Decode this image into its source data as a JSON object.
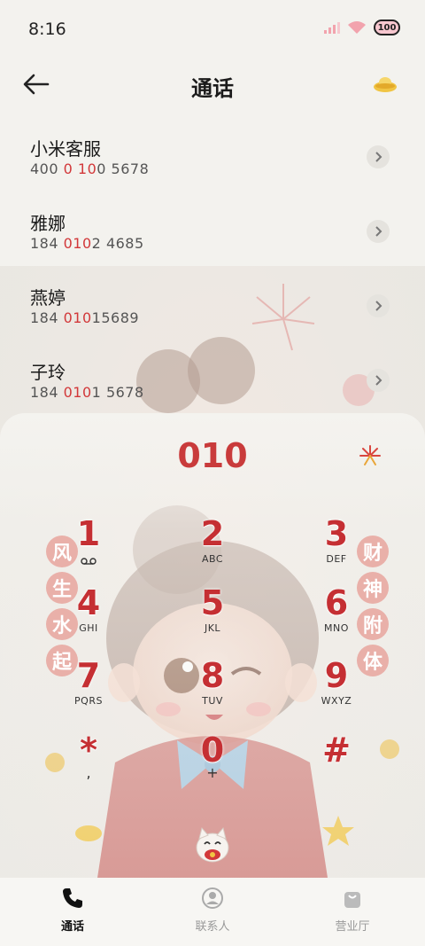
{
  "status_bar": {
    "time": "8:16",
    "battery": "100"
  },
  "header": {
    "title": "通话"
  },
  "contacts": [
    {
      "name": "小米客服",
      "num_pre": "400 ",
      "num_hl1": "0",
      "num_mid": " ",
      "num_hl2": "10",
      "num_post": "0 5678"
    },
    {
      "name": "雅娜",
      "num_pre": "184 ",
      "num_hl1": "010",
      "num_mid": "",
      "num_hl2": "",
      "num_post": "2 4685"
    },
    {
      "name": "燕婷",
      "num_pre": "184 ",
      "num_hl1": "010",
      "num_mid": "",
      "num_hl2": "",
      "num_post": "15689"
    },
    {
      "name": "子玲",
      "num_pre": "184 ",
      "num_hl1": "010",
      "num_mid": "",
      "num_hl2": "",
      "num_post": "1 5678"
    }
  ],
  "dialer": {
    "input": "010",
    "keys": [
      {
        "digit": "1",
        "sub": "voicemail-icon"
      },
      {
        "digit": "2",
        "sub": "ABC"
      },
      {
        "digit": "3",
        "sub": "DEF"
      },
      {
        "digit": "4",
        "sub": "GHI"
      },
      {
        "digit": "5",
        "sub": "JKL"
      },
      {
        "digit": "6",
        "sub": "MNO"
      },
      {
        "digit": "7",
        "sub": "PQRS"
      },
      {
        "digit": "8",
        "sub": "TUV"
      },
      {
        "digit": "9",
        "sub": "WXYZ"
      },
      {
        "digit": "*",
        "sub": ","
      },
      {
        "digit": "0",
        "sub": "+"
      },
      {
        "digit": "#",
        "sub": ""
      }
    ],
    "left_chars": [
      "风",
      "生",
      "水",
      "起"
    ],
    "right_chars": [
      "财",
      "神",
      "附",
      "体"
    ]
  },
  "nav": {
    "tabs": [
      {
        "label": "通话",
        "icon": "phone-icon",
        "active": true
      },
      {
        "label": "联系人",
        "icon": "contacts-icon",
        "active": false
      },
      {
        "label": "营业厅",
        "icon": "shop-bag-icon",
        "active": false
      }
    ]
  },
  "colors": {
    "accent_red": "#c52f33",
    "highlight_red": "#d2383a"
  }
}
